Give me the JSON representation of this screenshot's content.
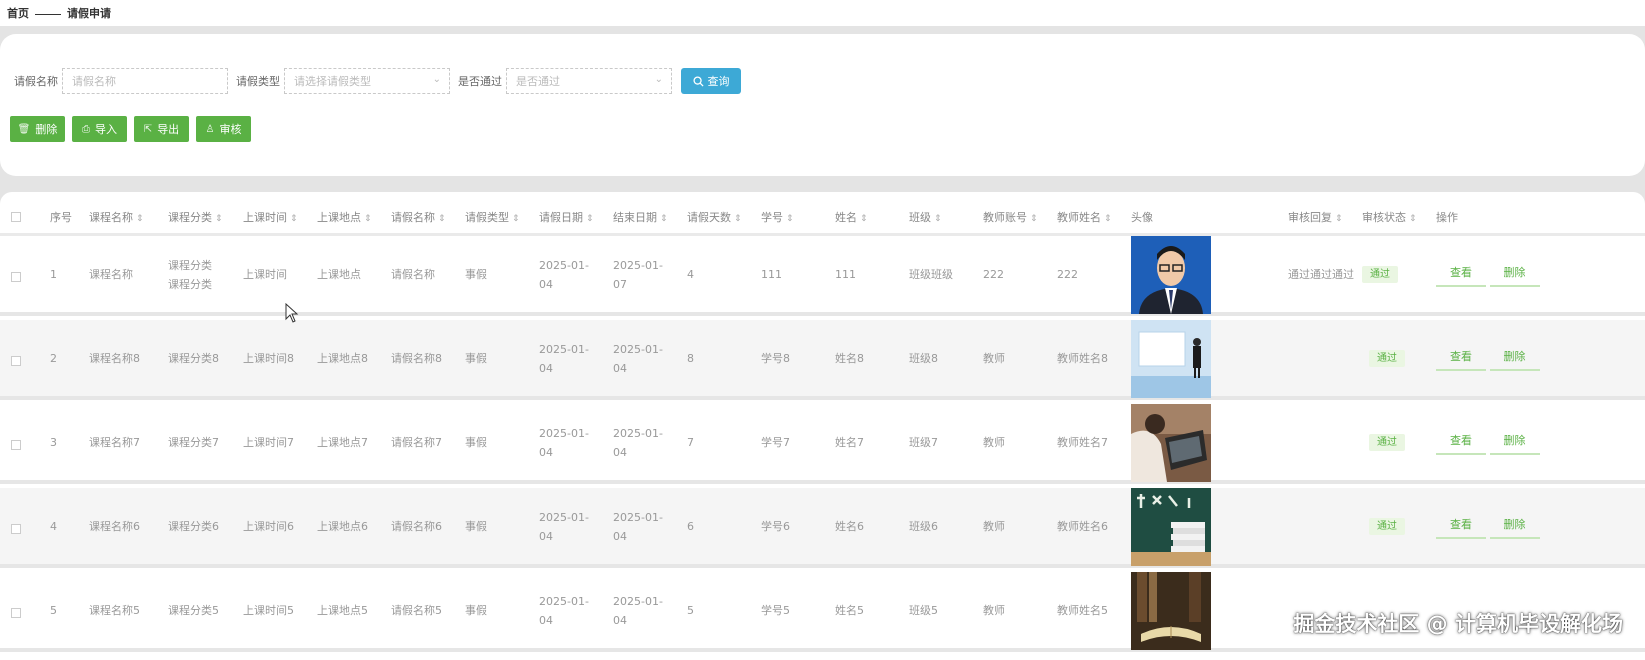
{
  "breadcrumb": {
    "home": "首页",
    "current": "请假申请"
  },
  "search": {
    "name_label": "请假名称",
    "name_placeholder": "请假名称",
    "type_label": "请假类型",
    "type_placeholder": "请选择请假类型",
    "pass_label": "是否通过",
    "pass_placeholder": "是否通过",
    "query_button": "查询"
  },
  "actions": {
    "delete": "删除",
    "import": "导入",
    "export": "导出",
    "audit": "审核"
  },
  "table": {
    "headers": [
      "序号",
      "课程名称",
      "课程分类",
      "上课时间",
      "上课地点",
      "请假名称",
      "请假类型",
      "请假日期",
      "结束日期",
      "请假天数",
      "学号",
      "姓名",
      "班级",
      "教师账号",
      "教师姓名",
      "头像",
      "审核回复",
      "审核状态",
      "操作"
    ],
    "rows": [
      {
        "idx": "1",
        "course": "课程名称",
        "cat1": "课程分类",
        "cat2": "课程分类",
        "time": "上课时间",
        "place": "上课地点",
        "leave_name": "请假名称",
        "leave_type": "事假",
        "start1": "2025-01-",
        "start2": "04",
        "end1": "2025-01-",
        "end2": "07",
        "days": "4",
        "sno": "111",
        "sname": "111",
        "cls": "班级班级",
        "tacct": "222",
        "tname": "222",
        "reply": "通过通过通过",
        "status": "通过",
        "view": "查看",
        "del": "删除"
      },
      {
        "idx": "2",
        "course": "课程名称8",
        "cat1": "课程分类8",
        "cat2": "",
        "time": "上课时间8",
        "place": "上课地点8",
        "leave_name": "请假名称8",
        "leave_type": "事假",
        "start1": "2025-01-",
        "start2": "04",
        "end1": "2025-01-",
        "end2": "04",
        "days": "8",
        "sno": "学号8",
        "sname": "姓名8",
        "cls": "班级8",
        "tacct": "教师",
        "tname": "教师姓名8",
        "reply": "",
        "status": "通过",
        "view": "查看",
        "del": "删除"
      },
      {
        "idx": "3",
        "course": "课程名称7",
        "cat1": "课程分类7",
        "cat2": "",
        "time": "上课时间7",
        "place": "上课地点7",
        "leave_name": "请假名称7",
        "leave_type": "事假",
        "start1": "2025-01-",
        "start2": "04",
        "end1": "2025-01-",
        "end2": "04",
        "days": "7",
        "sno": "学号7",
        "sname": "姓名7",
        "cls": "班级7",
        "tacct": "教师",
        "tname": "教师姓名7",
        "reply": "",
        "status": "通过",
        "view": "查看",
        "del": "删除"
      },
      {
        "idx": "4",
        "course": "课程名称6",
        "cat1": "课程分类6",
        "cat2": "",
        "time": "上课时间6",
        "place": "上课地点6",
        "leave_name": "请假名称6",
        "leave_type": "事假",
        "start1": "2025-01-",
        "start2": "04",
        "end1": "2025-01-",
        "end2": "04",
        "days": "6",
        "sno": "学号6",
        "sname": "姓名6",
        "cls": "班级6",
        "tacct": "教师",
        "tname": "教师姓名6",
        "reply": "",
        "status": "通过",
        "view": "查看",
        "del": "删除"
      },
      {
        "idx": "5",
        "course": "课程名称5",
        "cat1": "课程分类5",
        "cat2": "",
        "time": "上课时间5",
        "place": "上课地点5",
        "leave_name": "请假名称5",
        "leave_type": "事假",
        "start1": "2025-01-",
        "start2": "04",
        "end1": "2025-01-",
        "end2": "04",
        "days": "5",
        "sno": "学号5",
        "sname": "姓名5",
        "cls": "班级5",
        "tacct": "教师",
        "tname": "教师姓名5",
        "reply": "",
        "status": "",
        "view": "",
        "del": ""
      }
    ]
  },
  "watermark": "掘金技术社区 @ 计算机毕设解化场",
  "colors": {
    "accent_green": "#5ab144",
    "accent_blue": "#3da9d6"
  }
}
